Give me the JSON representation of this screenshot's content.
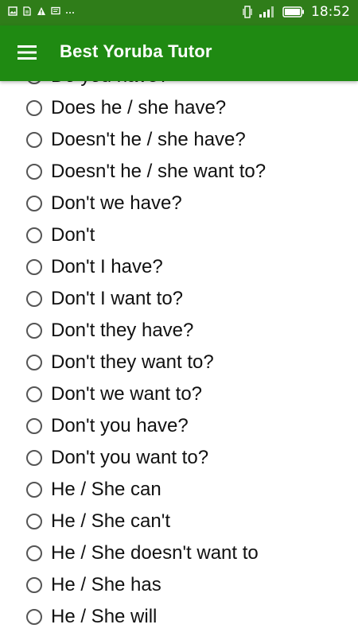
{
  "status_bar": {
    "time": "18:52",
    "icons": [
      "image-icon",
      "sim-icon",
      "warning-icon",
      "message-icon",
      "more-icon",
      "vibrate-icon",
      "signal-icon",
      "battery-icon"
    ]
  },
  "app_bar": {
    "title": "Best Yoruba Tutor",
    "menu_icon": "hamburger-menu-icon"
  },
  "options": [
    "Do you have?",
    "Does he / she have?",
    "Doesn't he / she have?",
    "Doesn't he / she want to?",
    "Don't we have?",
    "Don't",
    "Don't I have?",
    "Don't I want to?",
    "Don't they have?",
    "Don't they want to?",
    "Don't we want to?",
    "Don't you have?",
    "Don't you want to?",
    "He / She can",
    "He / She can't",
    "He / She doesn't want to",
    "He / She has",
    "He / She will"
  ],
  "colors": {
    "status_bar": "#2f7d19",
    "app_bar": "#1f8a12"
  }
}
